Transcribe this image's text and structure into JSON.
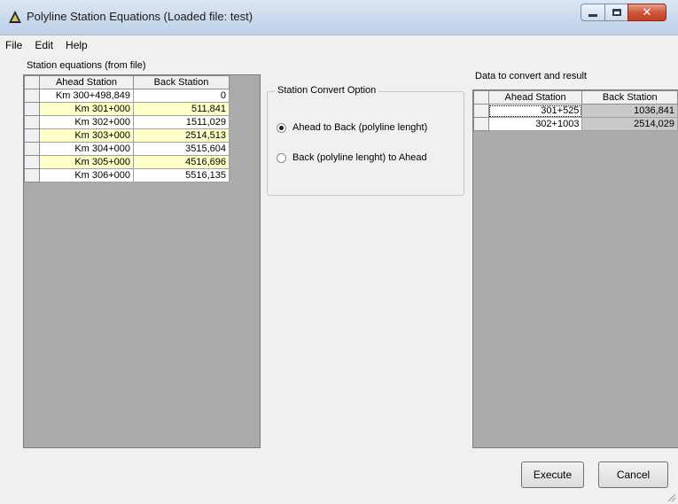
{
  "window": {
    "title": "Polyline Station Equations  (Loaded file: test)"
  },
  "menu": [
    "File",
    "Edit",
    "Help"
  ],
  "left_panel": {
    "label": "Station equations (from file)",
    "columns": [
      "Ahead Station",
      "Back Station"
    ],
    "rows": [
      {
        "ahead": "Km 300+498,849",
        "back": "0",
        "highlight": false
      },
      {
        "ahead": "Km 301+000",
        "back": "511,841",
        "highlight": true
      },
      {
        "ahead": "Km 302+000",
        "back": "1511,029",
        "highlight": false
      },
      {
        "ahead": "Km 303+000",
        "back": "2514,513",
        "highlight": true
      },
      {
        "ahead": "Km 304+000",
        "back": "3515,604",
        "highlight": false
      },
      {
        "ahead": "Km 305+000",
        "back": "4516,696",
        "highlight": true
      },
      {
        "ahead": "Km 306+000",
        "back": "5516,135",
        "highlight": false
      }
    ]
  },
  "options": {
    "title": "Station Convert Option",
    "ahead_to_back": "Ahead to Back (polyline lenght)",
    "back_to_ahead": "Back (polyline lenght) to Ahead",
    "selected": "ahead_to_back"
  },
  "right_panel": {
    "label": "Data to convert and result",
    "columns": [
      "Ahead Station",
      "Back Station"
    ],
    "rows": [
      {
        "ahead": "301+525",
        "back": "1036,841"
      },
      {
        "ahead": "302+1003",
        "back": "2514,029"
      }
    ]
  },
  "buttons": {
    "execute": "Execute",
    "cancel": "Cancel"
  }
}
